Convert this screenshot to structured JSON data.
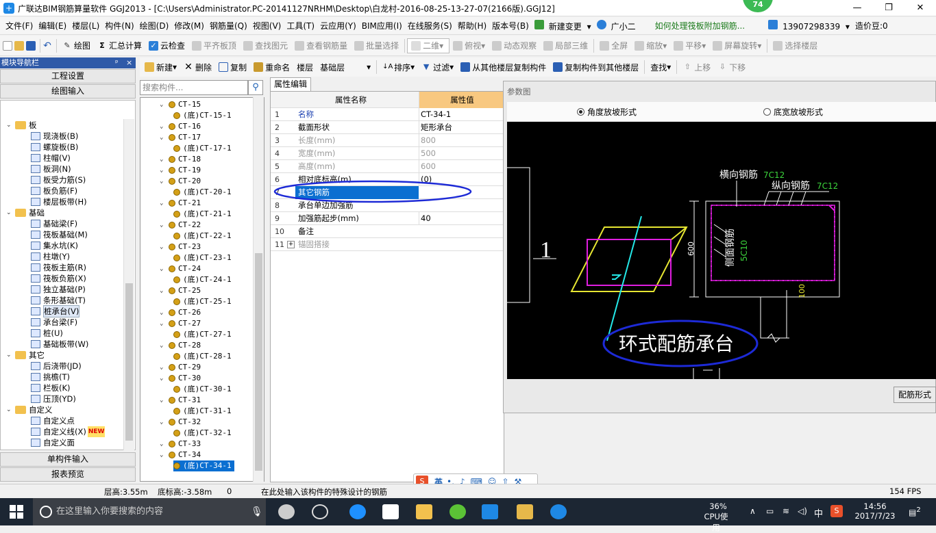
{
  "window": {
    "title": "广联达BIM钢筋算量软件 GGJ2013 - [C:\\Users\\Administrator.PC-20141127NRHM\\Desktop\\白龙村-2016-08-25-13-27-07(2166版).GGJ12]",
    "badge": "74"
  },
  "menu": [
    "文件(F)",
    "编辑(E)",
    "楼层(L)",
    "构件(N)",
    "绘图(D)",
    "修改(M)",
    "钢筋量(Q)",
    "视图(V)",
    "工具(T)",
    "云应用(Y)",
    "BIM应用(I)",
    "在线服务(S)",
    "帮助(H)",
    "版本号(B)",
    "新建变更",
    "广小二",
    "如何处理筏板附加钢筋...",
    "13907298339",
    "造价豆:0"
  ],
  "toolbar1": [
    "绘图",
    "汇总计算",
    "云检查",
    "平齐板顶",
    "查找图元",
    "查看钢筋量",
    "批量选择",
    "二维",
    "俯视",
    "动态观察",
    "局部三维",
    "全屏",
    "缩放",
    "平移",
    "屏幕旋转",
    "选择楼层"
  ],
  "toolbar2": [
    "新建",
    "删除",
    "复制",
    "重命名",
    "楼层",
    "基础层",
    "排序",
    "过滤",
    "从其他楼层复制构件",
    "复制构件到其他楼层",
    "查找",
    "上移",
    "下移"
  ],
  "nav": {
    "header": "模块导航栏",
    "pin": "ᵖ",
    "close": "×",
    "btn_project": "工程设置",
    "btn_draw": "绘图输入",
    "btn_single": "单构件输入",
    "btn_report": "报表预览",
    "tree": [
      {
        "label": "板",
        "type": "folder",
        "level": 0
      },
      {
        "label": "现浇板(B)",
        "level": 1
      },
      {
        "label": "螺旋板(B)",
        "level": 1
      },
      {
        "label": "柱帽(V)",
        "level": 1
      },
      {
        "label": "板洞(N)",
        "level": 1
      },
      {
        "label": "板受力筋(S)",
        "level": 1
      },
      {
        "label": "板负筋(F)",
        "level": 1
      },
      {
        "label": "楼层板带(H)",
        "level": 1
      },
      {
        "label": "基础",
        "type": "folder",
        "level": 0
      },
      {
        "label": "基础梁(F)",
        "level": 1
      },
      {
        "label": "筏板基础(M)",
        "level": 1
      },
      {
        "label": "集水坑(K)",
        "level": 1
      },
      {
        "label": "柱墩(Y)",
        "level": 1
      },
      {
        "label": "筏板主筋(R)",
        "level": 1
      },
      {
        "label": "筏板负筋(X)",
        "level": 1
      },
      {
        "label": "独立基础(P)",
        "level": 1
      },
      {
        "label": "条形基础(T)",
        "level": 1
      },
      {
        "label": "桩承台(V)",
        "level": 1,
        "selected": true
      },
      {
        "label": "承台梁(F)",
        "level": 1
      },
      {
        "label": "桩(U)",
        "level": 1
      },
      {
        "label": "基础板带(W)",
        "level": 1
      },
      {
        "label": "其它",
        "type": "folder",
        "level": 0
      },
      {
        "label": "后浇带(JD)",
        "level": 1
      },
      {
        "label": "挑檐(T)",
        "level": 1
      },
      {
        "label": "栏板(K)",
        "level": 1
      },
      {
        "label": "压顶(YD)",
        "level": 1
      },
      {
        "label": "自定义",
        "type": "folder",
        "level": 0
      },
      {
        "label": "自定义点",
        "level": 1
      },
      {
        "label": "自定义线(X)",
        "level": 1,
        "new": "NEW"
      },
      {
        "label": "自定义面",
        "level": 1
      }
    ]
  },
  "search": {
    "placeholder": "搜索构件..."
  },
  "components": [
    {
      "label": "CT-15",
      "level": 0
    },
    {
      "label": "(底)CT-15-1",
      "level": 1
    },
    {
      "label": "CT-16",
      "level": 0
    },
    {
      "label": "CT-17",
      "level": 0
    },
    {
      "label": "(底)CT-17-1",
      "level": 1
    },
    {
      "label": "CT-18",
      "level": 0
    },
    {
      "label": "CT-19",
      "level": 0
    },
    {
      "label": "CT-20",
      "level": 0
    },
    {
      "label": "(底)CT-20-1",
      "level": 1
    },
    {
      "label": "CT-21",
      "level": 0
    },
    {
      "label": "(底)CT-21-1",
      "level": 1
    },
    {
      "label": "CT-22",
      "level": 0
    },
    {
      "label": "(底)CT-22-1",
      "level": 1
    },
    {
      "label": "CT-23",
      "level": 0
    },
    {
      "label": "(底)CT-23-1",
      "level": 1
    },
    {
      "label": "CT-24",
      "level": 0
    },
    {
      "label": "(底)CT-24-1",
      "level": 1
    },
    {
      "label": "CT-25",
      "level": 0
    },
    {
      "label": "(底)CT-25-1",
      "level": 1
    },
    {
      "label": "CT-26",
      "level": 0
    },
    {
      "label": "CT-27",
      "level": 0
    },
    {
      "label": "(底)CT-27-1",
      "level": 1
    },
    {
      "label": "CT-28",
      "level": 0
    },
    {
      "label": "(底)CT-28-1",
      "level": 1
    },
    {
      "label": "CT-29",
      "level": 0
    },
    {
      "label": "CT-30",
      "level": 0
    },
    {
      "label": "(底)CT-30-1",
      "level": 1
    },
    {
      "label": "CT-31",
      "level": 0
    },
    {
      "label": "(底)CT-31-1",
      "level": 1
    },
    {
      "label": "CT-32",
      "level": 0
    },
    {
      "label": "(底)CT-32-1",
      "level": 1
    },
    {
      "label": "CT-33",
      "level": 0
    },
    {
      "label": "CT-34",
      "level": 0
    },
    {
      "label": "(底)CT-34-1",
      "level": 1,
      "selected": true
    }
  ],
  "props": {
    "tab": "属性编辑",
    "col_name": "属性名称",
    "col_value": "属性值",
    "rows": [
      {
        "n": "1",
        "k": "名称",
        "v": "CT-34-1",
        "style": "blue"
      },
      {
        "n": "2",
        "k": "截面形状",
        "v": "矩形承台"
      },
      {
        "n": "3",
        "k": "长度(mm)",
        "v": "800",
        "style": "gray"
      },
      {
        "n": "4",
        "k": "宽度(mm)",
        "v": "500",
        "style": "gray"
      },
      {
        "n": "5",
        "k": "高度(mm)",
        "v": "600",
        "style": "gray"
      },
      {
        "n": "6",
        "k": "相对底标高(m)",
        "v": "(0)"
      },
      {
        "n": "7",
        "k": "其它钢筋",
        "v": "",
        "selected": true
      },
      {
        "n": "8",
        "k": "承台单边加强筋",
        "v": ""
      },
      {
        "n": "9",
        "k": "加强筋起步(mm)",
        "v": "40"
      },
      {
        "n": "10",
        "k": "备注",
        "v": ""
      },
      {
        "n": "11",
        "k": "锚固搭接",
        "v": "",
        "expander": "+",
        "style": "gray"
      }
    ]
  },
  "param": {
    "title": "参数图",
    "radio1": "角度放坡形式",
    "radio2": "底宽放坡形式",
    "btn": "配筋形式",
    "drawing": {
      "label_1": "1",
      "h_bar": "横向钢筋",
      "h_bar_val": "7C12",
      "v_bar": "纵向钢筋",
      "v_bar_val": "7C12",
      "side_bar": "侧面钢筋",
      "side_bar_val": "5C10",
      "dim_600": "600",
      "dim_100": "100",
      "caption": "环式配筋承台"
    }
  },
  "status": {
    "floor_height": "层高:3.55m",
    "bottom_elev": "底标高:-3.58m",
    "zero": "0",
    "hint": "在此处输入该构件的特殊设计的钢筋",
    "fps": "154 FPS"
  },
  "ime": {
    "mode": "英"
  },
  "taskbar": {
    "search_placeholder": "在这里输入你要搜索的内容",
    "cpu_pct": "36%",
    "cpu_label": "CPU使用",
    "lang": "中",
    "time": "14:56",
    "date": "2017/7/23",
    "notif": "2"
  },
  "colors": {
    "accent": "#0b6fd1",
    "nav_header": "#2f5aa8",
    "value_header": "#f8c880",
    "ellipse": "#1d2ad6",
    "drawing_magenta": "#e01ee0",
    "drawing_yellow": "#e6e632",
    "drawing_cyan": "#24e8e8"
  }
}
